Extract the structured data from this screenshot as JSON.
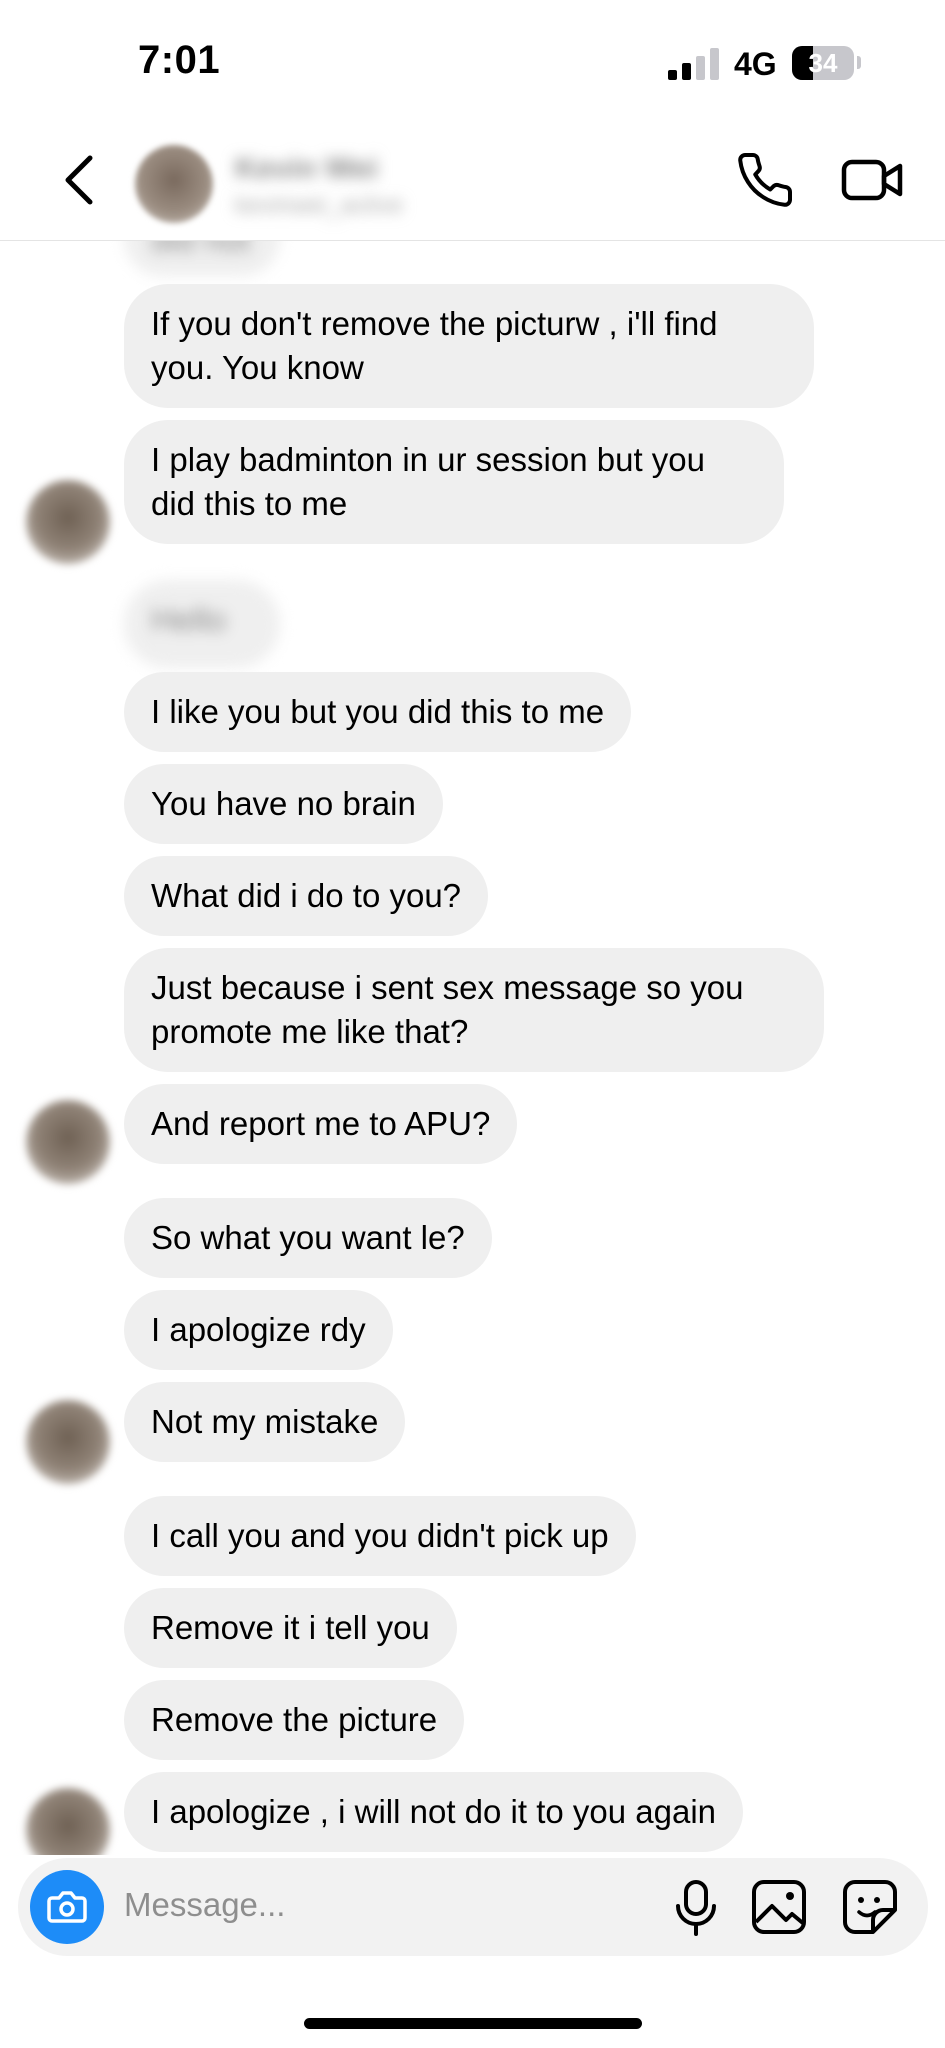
{
  "status_bar": {
    "time": "7:01",
    "network": "4G",
    "battery": "34"
  },
  "header": {
    "contact_name": "Kevin Wei",
    "contact_subtitle": "kevinwei_active"
  },
  "messages": [
    {
      "text": "did not"
    },
    {
      "text": "If you don't remove the picturw , i'll find you. You know"
    },
    {
      "text": "I play badminton in ur session but you did this to me"
    },
    {
      "text": "Hello"
    },
    {
      "text": "I like you but you did this to me"
    },
    {
      "text": "You have no brain"
    },
    {
      "text": "What did i do to you?"
    },
    {
      "text": "Just because i sent sex message so you promote me like that?"
    },
    {
      "text": "And report me to APU?"
    },
    {
      "text": "So what you want le?"
    },
    {
      "text": "I apologize rdy"
    },
    {
      "text": "Not my mistake"
    },
    {
      "text": "I call you and you didn't pick up"
    },
    {
      "text": "Remove it i tell you"
    },
    {
      "text": "Remove the picture"
    },
    {
      "text": "I apologize , i will not do it to you again"
    }
  ],
  "composer": {
    "placeholder": "Message..."
  },
  "icons": {
    "back": "chevron-left-icon",
    "call": "phone-icon",
    "video": "video-camera-icon",
    "camera": "camera-icon",
    "mic": "microphone-icon",
    "gallery": "image-gallery-icon",
    "sticker": "sticker-icon"
  },
  "colors": {
    "bubble": "#efefef",
    "accent": "#1d8cf8",
    "composer": "#f2f2f2"
  }
}
